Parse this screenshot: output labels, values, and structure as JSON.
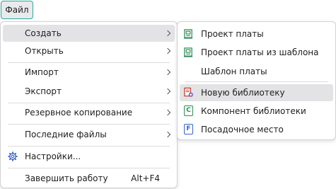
{
  "menubar": {
    "file_label": "Файл"
  },
  "main_menu": {
    "items": [
      {
        "label": "Создать",
        "has_submenu": true
      },
      {
        "label": "Открыть",
        "has_submenu": true
      },
      {
        "label": "Импорт",
        "has_submenu": true
      },
      {
        "label": "Экспорт",
        "has_submenu": true
      },
      {
        "label": "Резервное копирование",
        "has_submenu": true
      },
      {
        "label": "Последние файлы",
        "has_submenu": true
      },
      {
        "label": "Настройки...",
        "icon": "gear-icon"
      },
      {
        "label": "Завершить работу",
        "shortcut": "Alt+F4"
      }
    ]
  },
  "submenu": {
    "items": [
      {
        "label": "Проект платы",
        "icon": "board-project-icon"
      },
      {
        "label": "Проект платы из шаблона",
        "icon": "board-template-project-icon"
      },
      {
        "label": "Шаблон платы"
      },
      {
        "label": "Новую библиотеку",
        "icon": "new-library-icon"
      },
      {
        "label": "Компонент библиотеки",
        "icon": "component-icon",
        "icon_letter": "C"
      },
      {
        "label": "Посадочное место",
        "icon": "footprint-icon",
        "icon_letter": "F"
      }
    ]
  },
  "colors": {
    "accent": "#2aa89b",
    "highlight": "#e3e3e6",
    "icon_green": "#2e8b57",
    "icon_blue": "#3a63c7",
    "icon_red": "#c0392b"
  }
}
